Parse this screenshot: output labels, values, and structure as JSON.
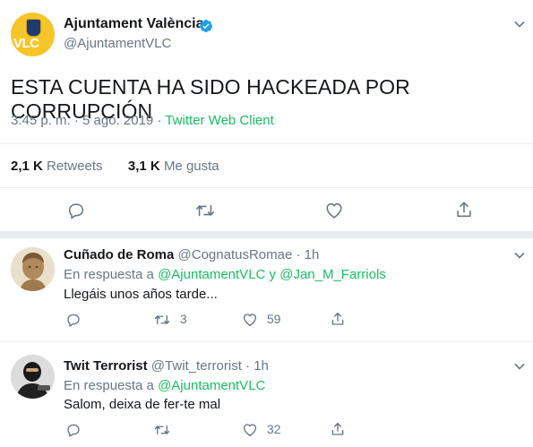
{
  "tweet": {
    "author_name": "Ajuntament València",
    "author_handle": "@AjuntamentVLC",
    "avatar_text": "VLC",
    "text": "ESTA CUENTA HA SIDO HACKEADA POR CORRUPCIÓN",
    "time": "3:45 p. m. · 5 ago. 2019 · ",
    "source": "Twitter Web Client",
    "retweets_count": "2,1 K",
    "retweets_label": "Retweets",
    "likes_count": "3,1 K",
    "likes_label": "Me gusta"
  },
  "replies": [
    {
      "name": "Cuñado de Roma",
      "handle": "@CognatusRomae",
      "time": "· 1h",
      "in_reply_prefix": "En respuesta a ",
      "in_reply_links": [
        "@AjuntamentVLC",
        "@Jan_M_Farriols"
      ],
      "in_reply_joiner": " y ",
      "text": "Llegáis unos años tarde...",
      "retweets": "3",
      "likes": "59"
    },
    {
      "name": "Twit Terrorist",
      "handle": "@Twit_terrorist",
      "time": "· 1h",
      "in_reply_prefix": "En respuesta a ",
      "in_reply_links": [
        "@AjuntamentVLC"
      ],
      "text": "Salom, deixa de fer-te mal",
      "retweets": "",
      "likes": "32"
    }
  ],
  "colors": {
    "accent_green": "#17bf63",
    "verified_blue": "#1da1f2",
    "muted": "#657786",
    "divider": "#e6ecf0"
  }
}
